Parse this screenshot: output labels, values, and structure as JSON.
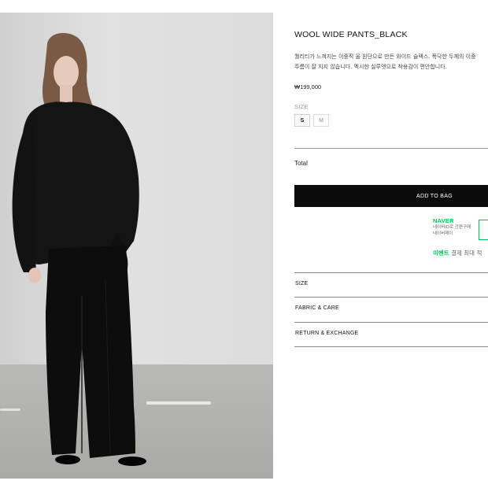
{
  "product": {
    "title": "WOOL WIDE PANTS_BLACK",
    "description_lines": [
      "퀄리티가 느껴지는 이중직 울 원단으로 만든 와이드 슬랙스. 폭닥한 두께의 이중",
      "주름이 잘 지지 않습니다. 멕시한 실루엣으로 착용감이 편안합니다."
    ],
    "price": "₩199,000"
  },
  "size": {
    "label": "SIZE",
    "options": [
      "S",
      "M"
    ],
    "selected": "S"
  },
  "total_label": "Total",
  "add_to_bag_label": "ADD TO BAG",
  "naver": {
    "brand": "NAVER",
    "line1": "네이버ID로 간편구매",
    "line2": "네이버페이"
  },
  "event": {
    "highlight": "이벤트",
    "text": "결제 최대 적"
  },
  "accordion": [
    "SIZE",
    "FABRIC & CARE",
    "RETURN & EXCHANGE"
  ],
  "colors": {
    "button_bg": "#0b0b0b",
    "naver_green": "#03c75a"
  }
}
